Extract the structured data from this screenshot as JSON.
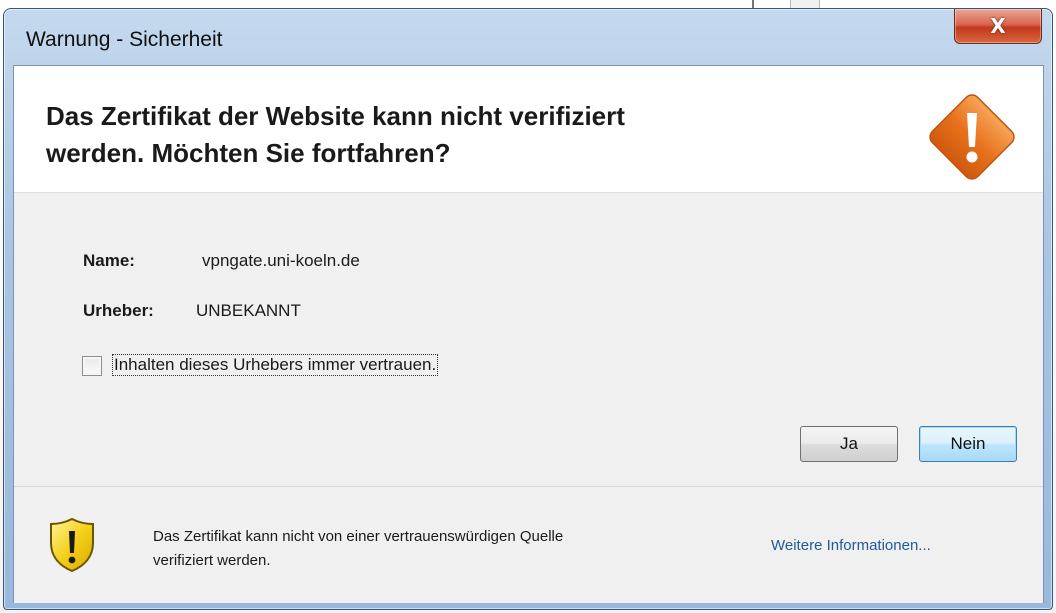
{
  "window": {
    "title": "Warnung - Sicherheit",
    "close_label": "X"
  },
  "header": {
    "headline_line1": "Das Zertifikat der Website kann nicht verifiziert",
    "headline_line2": "werden.  Möchten Sie fortfahren?",
    "icon": "warning-diamond-icon"
  },
  "details": {
    "name_label": "Name:",
    "name_value": "vpngate.uni-koeln.de",
    "publisher_label": "Urheber:",
    "publisher_value": "UNBEKANNT"
  },
  "trust_checkbox": {
    "label": "Inhalten dieses Urhebers immer vertrauen.",
    "checked": false
  },
  "buttons": {
    "yes_label": "Ja",
    "no_label": "Nein"
  },
  "footer": {
    "icon": "warning-shield-icon",
    "message_line1": "Das Zertifikat kann nicht von einer vertrauenswürdigen Quelle",
    "message_line2": "verifiziert werden.",
    "more_info_link": "Weitere Informationen..."
  },
  "colors": {
    "warning_orange": "#e8721c",
    "shield_yellow": "#f4d11a",
    "link_blue": "#1e5a9a"
  }
}
